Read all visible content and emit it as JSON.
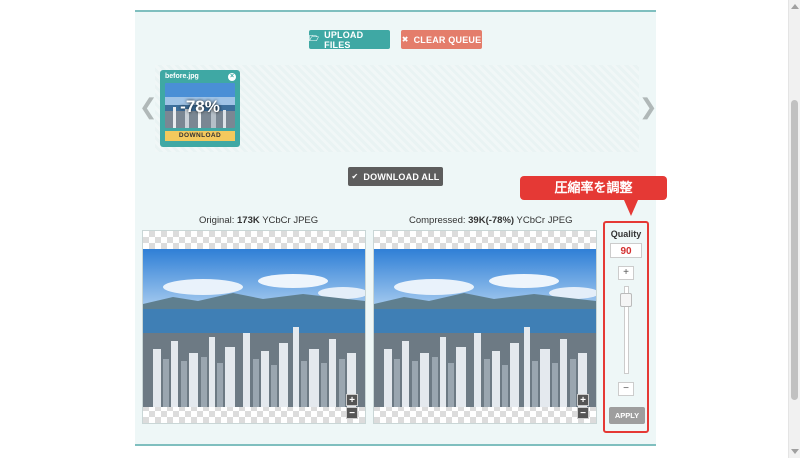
{
  "toolbar": {
    "upload_label": "UPLOAD FILES",
    "clear_label": "CLEAR QUEUE",
    "download_all_label": "DOWNLOAD ALL"
  },
  "queue": {
    "items": [
      {
        "filename": "before.jpg",
        "savings": "-78%",
        "download_label": "DOWNLOAD"
      }
    ],
    "prev_arrow": "❮",
    "next_arrow": "❯"
  },
  "preview": {
    "original": {
      "prefix": "Original:",
      "size": "173K",
      "format": "YCbCr JPEG"
    },
    "compressed": {
      "prefix": "Compressed:",
      "size": "39K(-78%)",
      "format": "YCbCr JPEG"
    },
    "zoom_in": "+",
    "zoom_out": "−"
  },
  "quality": {
    "title": "Quality",
    "value": "90",
    "level": 0.9,
    "increase": "+",
    "decrease": "−",
    "apply_label": "APPLY"
  },
  "annotation": {
    "callout_text": "圧縮率を調整"
  },
  "colors": {
    "teal": "#3fa8a4",
    "clear_red": "#e47d6b",
    "annotation_red": "#e53935",
    "quality_value": "#d32f2f"
  },
  "icons": {
    "upload": "folder-icon",
    "clear": "close-icon",
    "download_all": "check-icon"
  }
}
